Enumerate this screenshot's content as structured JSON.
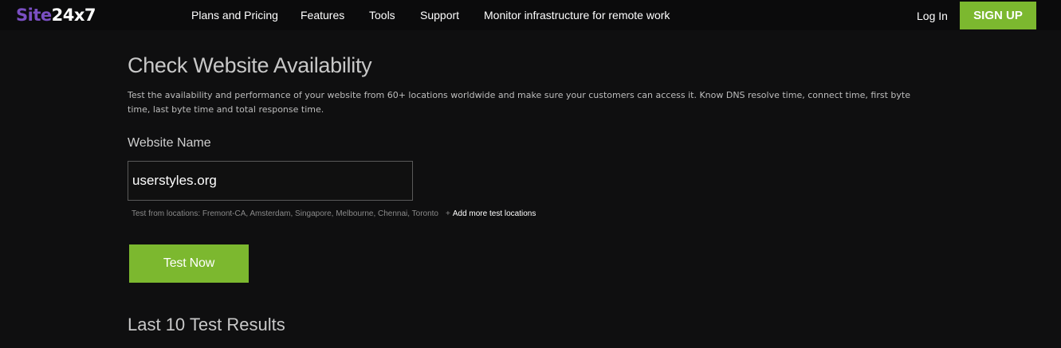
{
  "logo": {
    "site": "Site",
    "num": "24x7"
  },
  "nav": {
    "items": [
      {
        "label": "Plans and Pricing"
      },
      {
        "label": "Features"
      },
      {
        "label": "Tools"
      },
      {
        "label": "Support"
      },
      {
        "label": "Monitor infrastructure for remote work"
      }
    ],
    "login_label": "Log In",
    "signup_label": "SIGN UP"
  },
  "main": {
    "title": "Check Website Availability",
    "description": "Test the availability and performance of your website from 60+ locations worldwide and make sure your customers can access it. Know DNS resolve time, connect time, first byte time, last byte time and total response time.",
    "field_label": "Website Name",
    "website_value": "userstyles.org",
    "locations_text": "Test from locations: Fremont-CA, Amsterdam, Singapore, Melbourne, Chennai, Toronto",
    "plus": "+",
    "add_locations_label": "Add more test locations",
    "test_button_label": "Test Now",
    "results_title": "Last 10 Test Results"
  },
  "colors": {
    "accent_green": "#7cb82f",
    "logo_purple": "#7a4fc2",
    "background": "#0f0f10"
  }
}
